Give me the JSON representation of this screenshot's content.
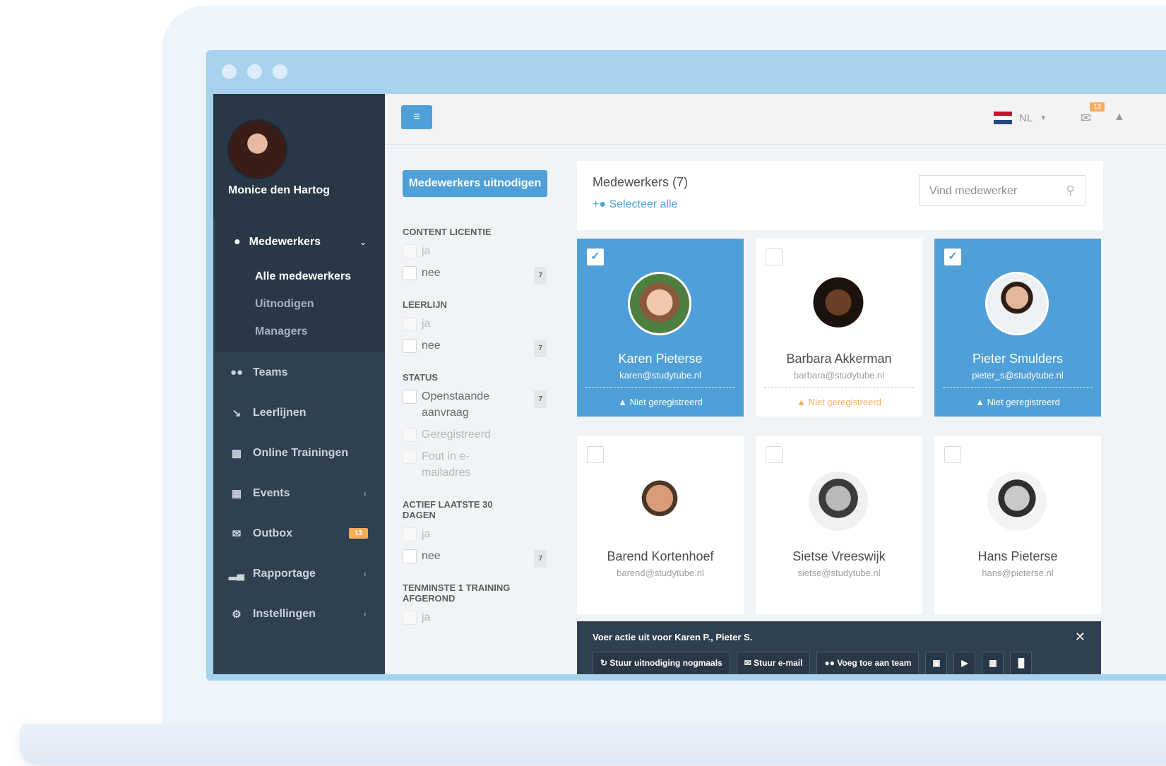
{
  "profile": {
    "name": "Monice den Hartog"
  },
  "sidebar": {
    "section_label": "Medewerkers",
    "sub_items": [
      "Alle medewerkers",
      "Uitnodigen",
      "Managers"
    ],
    "items": [
      {
        "label": "Teams",
        "icon": "users-icon"
      },
      {
        "label": "Leerlijnen",
        "icon": "line-chart-icon"
      },
      {
        "label": "Online Trainingen",
        "icon": "monitor-icon"
      },
      {
        "label": "Events",
        "icon": "calendar-icon"
      },
      {
        "label": "Outbox",
        "icon": "envelope-icon",
        "badge": "13"
      },
      {
        "label": "Rapportage",
        "icon": "bar-chart-icon"
      },
      {
        "label": "Instellingen",
        "icon": "gear-icon"
      }
    ]
  },
  "topbar": {
    "language": "NL",
    "mail_count": "13"
  },
  "filters": {
    "invite_label": "Medewerkers uitnodigen",
    "groups": [
      {
        "title": "CONTENT LICENTIE",
        "options": [
          {
            "label": "ja"
          },
          {
            "label": "nee",
            "count": "7"
          }
        ]
      },
      {
        "title": "LEERLIJN",
        "options": [
          {
            "label": "ja"
          },
          {
            "label": "nee",
            "count": "7"
          }
        ]
      },
      {
        "title": "STATUS",
        "options": [
          {
            "label": "Openstaande aanvraag",
            "count": "7"
          },
          {
            "label": "Geregistreerd"
          },
          {
            "label": "Fout in e-mailadres"
          }
        ]
      },
      {
        "title": "ACTIEF LAATSTE 30 DAGEN",
        "options": [
          {
            "label": "ja"
          },
          {
            "label": "nee",
            "count": "7"
          }
        ]
      },
      {
        "title": "TENMINSTE 1 TRAINING AFGEROND",
        "options": [
          {
            "label": "ja"
          }
        ]
      }
    ]
  },
  "main": {
    "title": "Medewerkers (7)",
    "select_all": "Selecteer alle",
    "search_placeholder": "Vind medewerker",
    "employees": [
      {
        "name": "Karen Pieterse",
        "email": "karen@studytube.nl",
        "status": "Niet geregistreerd",
        "selected": true
      },
      {
        "name": "Barbara Akkerman",
        "email": "barbara@studytube.nl",
        "status": "Niet geregistreerd",
        "selected": false
      },
      {
        "name": "Pieter Smulders",
        "email": "pieter_s@studytube.nl",
        "status": "Niet geregistreerd",
        "selected": true
      },
      {
        "name": "Barend Kortenhoef",
        "email": "barend@studytube.nl",
        "selected": false
      },
      {
        "name": "Sietse Vreeswijk",
        "email": "sietse@studytube.nl",
        "selected": false
      },
      {
        "name": "Hans Pieterse",
        "email": "hans@pieterse.nl",
        "selected": false
      }
    ]
  },
  "action_bar": {
    "title": "Voer actie uit voor Karen P., Pieter S.",
    "resend": "Stuur uitnodiging nogmaals",
    "email": "Stuur e-mail",
    "add_team": "Voeg toe aan team"
  },
  "colors": {
    "accent": "#4fa0d8",
    "sidebar": "#2f4050",
    "warning": "#f8ac59"
  }
}
